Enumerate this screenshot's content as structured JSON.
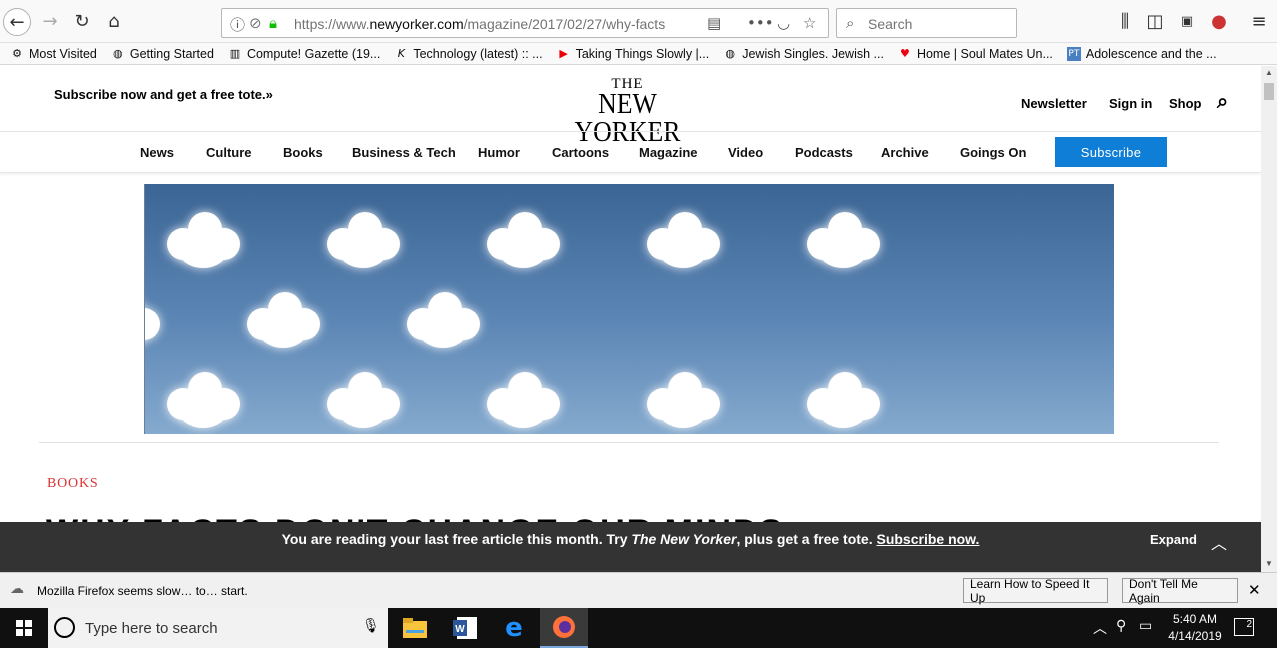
{
  "browser": {
    "url_prefix": "https://www.",
    "url_host": "newyorker.com",
    "url_path": "/magazine/2017/02/27/why-facts",
    "search_placeholder": "Search"
  },
  "bookmarks": [
    {
      "label": "Most Visited",
      "icon": "gear-icon"
    },
    {
      "label": "Getting Started",
      "icon": "globe-icon"
    },
    {
      "label": "Compute! Gazette (19...",
      "icon": "archive-icon"
    },
    {
      "label": "Technology (latest) :: ...",
      "icon": "k-logo-icon"
    },
    {
      "label": "Taking Things Slowly |...",
      "icon": "youtube-icon"
    },
    {
      "label": "Jewish Singles. Jewish ...",
      "icon": "globe-icon"
    },
    {
      "label": "Home | Soul Mates Un...",
      "icon": "heart-icon"
    },
    {
      "label": "Adolescence and the ...",
      "icon": "pt-icon"
    }
  ],
  "site": {
    "promo": "Subscribe now and get a free tote.»",
    "logo_the": "THE",
    "logo_name": "NEW YORKER",
    "header_links": {
      "newsletter": "Newsletter",
      "signin": "Sign in",
      "shop": "Shop"
    },
    "nav": [
      "News",
      "Culture",
      "Books",
      "Business & Tech",
      "Humor",
      "Cartoons",
      "Magazine",
      "Video",
      "Podcasts",
      "Archive",
      "Goings On"
    ],
    "subscribe": "Subscribe",
    "section": "BOOKS",
    "headline_peek": "WHY FACTS DON'T CHANGE OUR MINDS"
  },
  "paywall": {
    "msg_a": "You are reading your last free article this month. Try ",
    "msg_italic": "The New Yorker",
    "msg_b": ", plus get a free tote. ",
    "msg_link": "Subscribe now.",
    "expand": "Expand"
  },
  "notification": {
    "text": "Mozilla Firefox seems slow… to… start.",
    "learn": "Learn How to Speed It Up",
    "dismiss": "Don't Tell Me Again"
  },
  "taskbar": {
    "search_placeholder": "Type here to search",
    "time": "5:40 AM",
    "date": "4/14/2019",
    "notifications_count": "2"
  },
  "colors": {
    "accent": "#0f7ed6",
    "section": "#db3334",
    "paywall_bg": "#333333"
  }
}
